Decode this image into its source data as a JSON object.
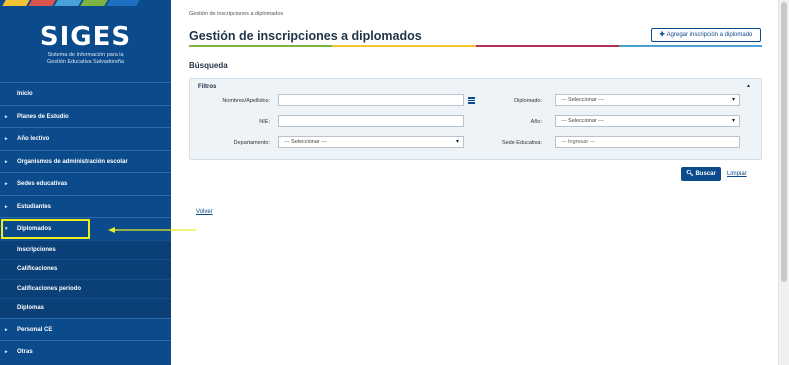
{
  "logo": {
    "title": "SIGES",
    "subtitle_line1": "Sistema de Información para la",
    "subtitle_line2": "Gestión Educativa Salvadoreña",
    "stripe_colors": [
      "#f1c232",
      "#d9534f",
      "#4aa1d6",
      "#7cb342",
      "#1d6fc2"
    ]
  },
  "sidebar": {
    "items": [
      {
        "label": "Inicio",
        "caret": ""
      },
      {
        "label": "Planes de Estudio",
        "caret": "▸"
      },
      {
        "label": "Año lectivo",
        "caret": "▸"
      },
      {
        "label": "Organismos de administración escolar",
        "caret": "▸"
      },
      {
        "label": "Sedes educativas",
        "caret": "▸"
      },
      {
        "label": "Estudiantes",
        "caret": "▸"
      },
      {
        "label": "Diplomados",
        "caret": "▾"
      },
      {
        "label": "Personal CE",
        "caret": "▸"
      },
      {
        "label": "Otras",
        "caret": "▸"
      }
    ],
    "subitems": [
      {
        "label": "Inscripciones"
      },
      {
        "label": "Calificaciones"
      },
      {
        "label": "Calificaciones periodo"
      },
      {
        "label": "Diplomas"
      }
    ]
  },
  "header": {
    "breadcrumb": "Gestión de inscripciones a diplomados",
    "title": "Gestión de inscripciones a diplomados",
    "add_button": "Agregar inscripción a diplomado",
    "line_colors": [
      "#7cb342",
      "#f1c232",
      "#b0325a",
      "#4aa1d6"
    ]
  },
  "search": {
    "section_title": "Búsqueda",
    "filters_title": "Filtros",
    "fields": {
      "nombres_label": "Nombres/Apellidos:",
      "nombres_value": "",
      "nie_label": "NIE:",
      "nie_value": "",
      "departamento_label": "Departamento:",
      "departamento_value": "--- Seleccionar ---",
      "diplomado_label": "Diplomado:",
      "diplomado_value": "--- Seleccionar ---",
      "anio_label": "Año:",
      "anio_value": "--- Seleccionar ---",
      "sede_label": "Sede Educativa:",
      "sede_placeholder": "--- Ingresar ---"
    },
    "search_button": "Buscar",
    "clear_link": "Limpiar"
  },
  "footer": {
    "back_link": "Volver"
  }
}
